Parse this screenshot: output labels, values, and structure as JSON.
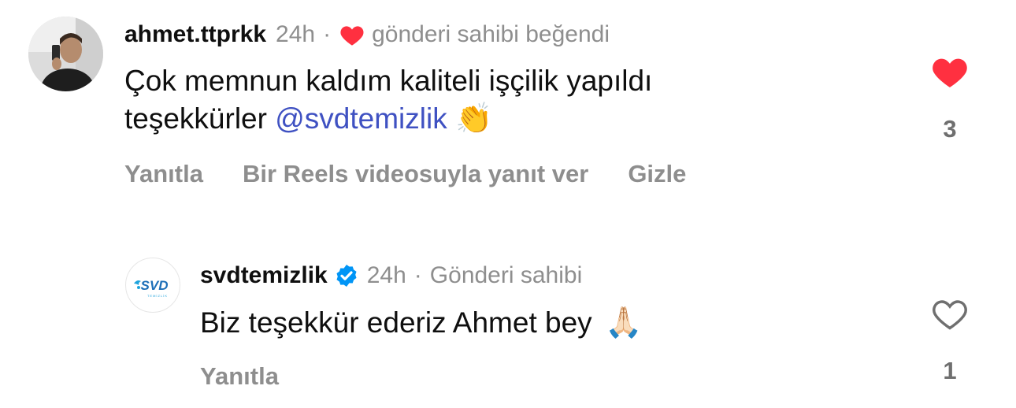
{
  "comments": [
    {
      "username": "ahmet.ttprkk",
      "time": "24h",
      "owner_liked": "gönderi sahibi beğendi",
      "text_line1": "Çok memnun kaldım kaliteli işçilik yapıldı",
      "text_line2_prefix": "teşekkürler",
      "mention": "@svdtemizlik",
      "emoji": "👏",
      "actions": [
        "Yanıtla",
        "Bir Reels videosuyla yanıt ver",
        "Gizle"
      ],
      "like_count": "3",
      "liked": true
    },
    {
      "username": "svdtemizlik",
      "verified": true,
      "time": "24h",
      "owner_badge": "Gönderi sahibi",
      "text": "Biz teşekkür ederiz Ahmet bey",
      "emoji": "🙏🏻",
      "actions": [
        "Yanıtla"
      ],
      "like_count": "1",
      "liked": false,
      "logo_text": "SVD",
      "logo_subtext": "TEMİZLİK"
    }
  ],
  "colors": {
    "heart_red": "#ff3040",
    "mention_blue": "#3f51c2",
    "verified_blue": "#0095f6",
    "muted_grey": "#8e8e8e"
  },
  "icons": {
    "liked": "heart-filled-icon",
    "unliked": "heart-outline-icon",
    "verified": "verified-badge-icon"
  }
}
